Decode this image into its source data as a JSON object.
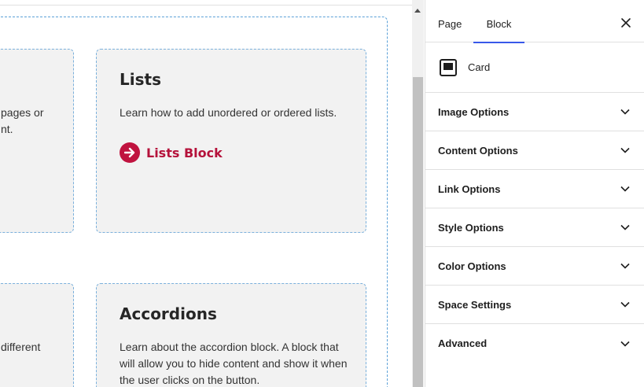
{
  "canvas": {
    "cards": [
      {
        "title": "",
        "text": "pages or\nnt.",
        "link": ""
      },
      {
        "title": "Lists",
        "text": "Learn how to add unordered or ordered lists.",
        "link": "Lists Block"
      },
      {
        "title": "",
        "text": "different",
        "link": ""
      },
      {
        "title": "Accordions",
        "text": "Learn about the accordion block. A block that will allow you to hide content and show it when the user clicks on the button.",
        "link": ""
      }
    ],
    "link_color": "#b5123b"
  },
  "sidebar": {
    "tabs": [
      {
        "label": "Page",
        "active": false
      },
      {
        "label": "Block",
        "active": true
      }
    ],
    "close_icon": "close-icon",
    "block": {
      "icon": "card-block-icon",
      "name": "Card"
    },
    "panels": [
      {
        "label": "Image Options"
      },
      {
        "label": "Content Options"
      },
      {
        "label": "Link Options"
      },
      {
        "label": "Style Options"
      },
      {
        "label": "Color Options"
      },
      {
        "label": "Space Settings"
      },
      {
        "label": "Advanced"
      }
    ],
    "accent": "#3858e9"
  }
}
